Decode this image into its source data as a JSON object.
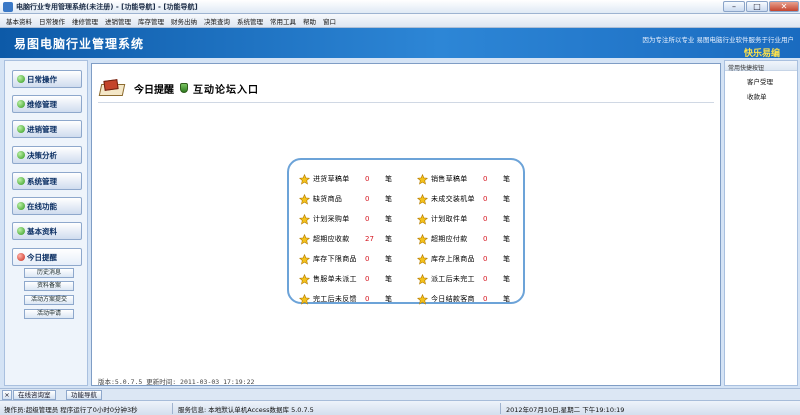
{
  "window": {
    "title": "电脑行业专用管理系统(未注册) - [功能导航] - [功能导航]"
  },
  "menu": [
    "基本资料",
    "日常操作",
    "维修管理",
    "进销管理",
    "库存管理",
    "财务出纳",
    "决策查询",
    "系统管理",
    "常用工具",
    "帮助",
    "窗口"
  ],
  "banner": {
    "logo_text": "易图电脑行业管理系统",
    "slogan": "因为专注所以专业    易图电脑行业软件服务于行业用户",
    "brand": "快乐易编"
  },
  "leftnav": {
    "items": [
      "日常操作",
      "维修管理",
      "进销管理",
      "决策分析",
      "系统管理",
      "在线功能",
      "基本资料",
      "今日提醒"
    ],
    "subitems": [
      "历史消息",
      "资料备案",
      "活动方案提交",
      "活动申请"
    ]
  },
  "main": {
    "heading1": "今日提醒",
    "heading2": "互动论坛入口",
    "unit": "笔",
    "reminders_left": [
      {
        "label": "进货草稿单",
        "value": "0"
      },
      {
        "label": "缺货商品",
        "value": "0"
      },
      {
        "label": "计划采购单",
        "value": "0"
      },
      {
        "label": "超期应收款",
        "value": "27"
      },
      {
        "label": "库存下限商品",
        "value": "0"
      },
      {
        "label": "售服单未派工",
        "value": "0"
      },
      {
        "label": "完工后未反馈",
        "value": "0"
      }
    ],
    "reminders_right": [
      {
        "label": "销售草稿单",
        "value": "0"
      },
      {
        "label": "未成交装机单",
        "value": "0"
      },
      {
        "label": "计划取件单",
        "value": "0"
      },
      {
        "label": "超期应付款",
        "value": "0"
      },
      {
        "label": "库存上限商品",
        "value": "0"
      },
      {
        "label": "派工后未完工",
        "value": "0"
      },
      {
        "label": "今日结款客商",
        "value": "0"
      }
    ],
    "version": "版本:5.0.7.5 更新时间: 2011-03-03 17:19:22"
  },
  "rightpanel": {
    "header": "常用快捷按钮",
    "items": [
      "客户受理",
      "收款单"
    ]
  },
  "bottom_tabs": [
    "在线咨询室",
    "功能导航"
  ],
  "status": {
    "operator": "操作员:超级管理员 程序运行了0小时0分钟3秒",
    "db": "服务信息: 本地默认单机Access数据库 5.0.7.5",
    "time": "2012年07月10日,星期二 下午19:10:19"
  },
  "colors": {
    "banner": "#1a6bc0",
    "accent_border": "#6ca3d8",
    "value_red": "#d4141e"
  }
}
